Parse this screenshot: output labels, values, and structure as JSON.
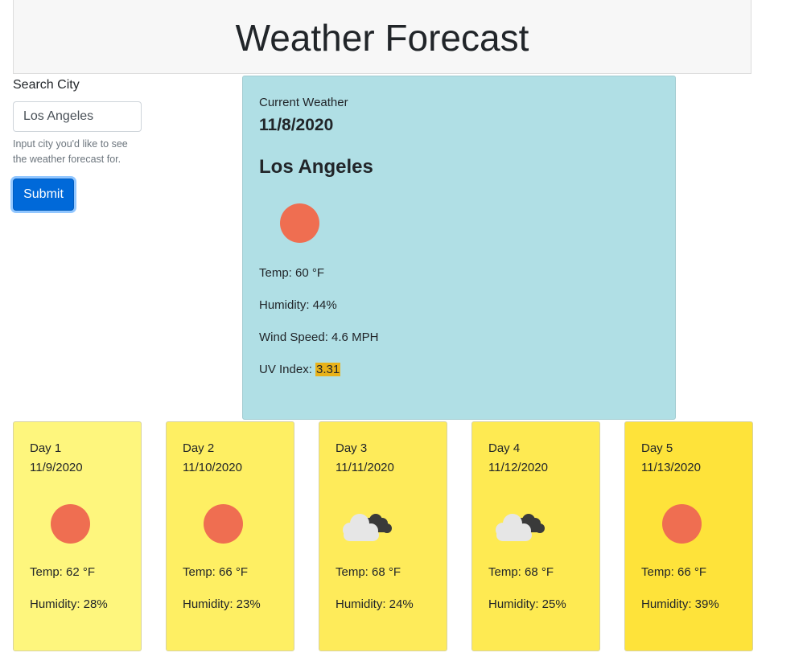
{
  "header": {
    "title": "Weather Forecast"
  },
  "search": {
    "label": "Search City",
    "value": "Los Angeles",
    "help": "Input city you'd like to see the weather forecast for.",
    "submit_label": "Submit"
  },
  "current": {
    "label": "Current Weather",
    "date": "11/8/2020",
    "city": "Los Angeles",
    "icon": "sun-icon",
    "temp_label": "Temp: 60 °F",
    "humidity_label": "Humidity: 44%",
    "wind_label": "Wind Speed: 4.6 MPH",
    "uv_prefix": "UV Index: ",
    "uv_value": "3.31",
    "uv_color": "#e8b21a",
    "background": "#b0dfe5"
  },
  "forecast": [
    {
      "day": "Day 1",
      "date": "11/9/2020",
      "icon": "sun-icon",
      "temp": "Temp: 62 °F",
      "humidity": "Humidity: 28%",
      "color": "#fef67d"
    },
    {
      "day": "Day 2",
      "date": "11/10/2020",
      "icon": "sun-icon",
      "temp": "Temp: 66 °F",
      "humidity": "Humidity: 23%",
      "color": "#feef63"
    },
    {
      "day": "Day 3",
      "date": "11/11/2020",
      "icon": "cloud-icon",
      "temp": "Temp: 68 °F",
      "humidity": "Humidity: 24%",
      "color": "#feeb5a"
    },
    {
      "day": "Day 4",
      "date": "11/12/2020",
      "icon": "cloud-icon",
      "temp": "Temp: 68 °F",
      "humidity": "Humidity: 25%",
      "color": "#feea52"
    },
    {
      "day": "Day 5",
      "date": "11/13/2020",
      "icon": "sun-icon",
      "temp": "Temp: 66 °F",
      "humidity": "Humidity: 39%",
      "color": "#fee33a"
    }
  ]
}
